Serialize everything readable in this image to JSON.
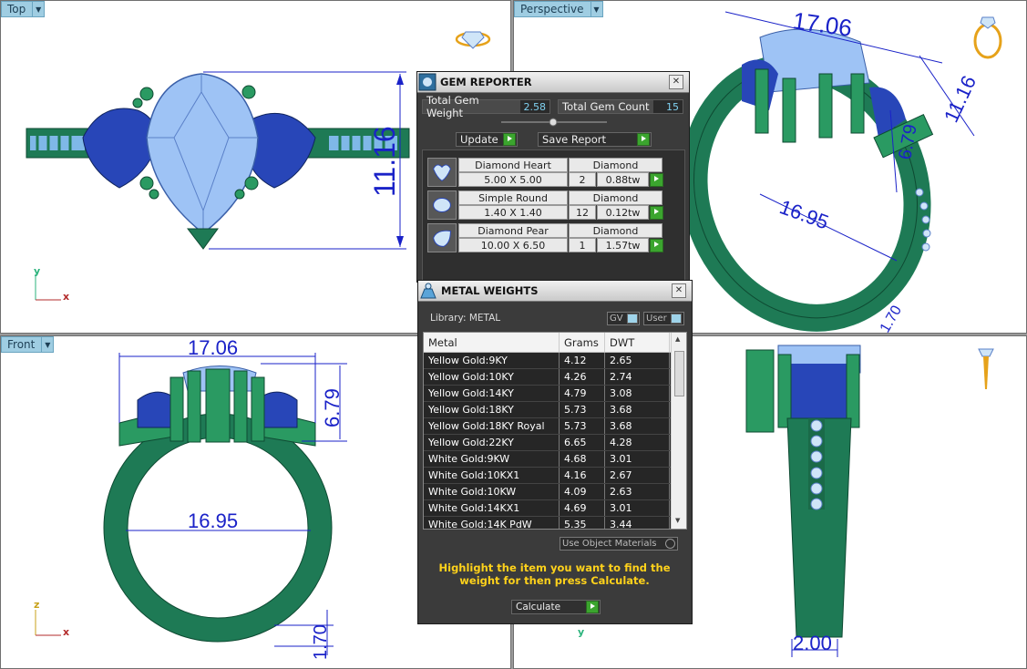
{
  "viewports": {
    "top": {
      "label": "Top",
      "dims": {
        "height": "11.16"
      }
    },
    "perspective": {
      "label": "Perspective",
      "dims": {
        "width": "17.06",
        "depth": "11.16",
        "inner": "16.95",
        "side": "6.79",
        "bottom": "1.70"
      }
    },
    "front": {
      "label": "Front",
      "dims": {
        "width": "17.06",
        "height": "6.79",
        "inner": "16.95",
        "band": "1.70"
      }
    },
    "right": {
      "label": "",
      "dims": {
        "band": "2.00"
      }
    }
  },
  "axes": {
    "x": "x",
    "y": "y",
    "z": "z"
  },
  "gem_reporter": {
    "title": "GEM REPORTER",
    "close": "✕",
    "total_weight_label": "Total Gem Weight",
    "total_weight_value": "2.58",
    "total_count_label": "Total Gem Count",
    "total_count_value": "15",
    "update_label": "Update",
    "save_report_label": "Save Report",
    "gems": [
      {
        "name": "Diamond Heart",
        "material": "Diamond",
        "size": "5.00 X 5.00",
        "count": "2",
        "weight": "0.88tw"
      },
      {
        "name": "Simple Round",
        "material": "Diamond",
        "size": "1.40 X 1.40",
        "count": "12",
        "weight": "0.12tw"
      },
      {
        "name": "Diamond Pear",
        "material": "Diamond",
        "size": "10.00 X 6.50",
        "count": "1",
        "weight": "1.57tw"
      }
    ]
  },
  "metal_weights": {
    "title": "METAL WEIGHTS",
    "close": "✕",
    "library_label": "Library: METAL",
    "gv_label": "GV",
    "user_label": "User",
    "columns": [
      "Metal",
      "Grams",
      "DWT"
    ],
    "rows": [
      [
        "Yellow Gold:9KY",
        "4.12",
        "2.65"
      ],
      [
        "Yellow Gold:10KY",
        "4.26",
        "2.74"
      ],
      [
        "Yellow Gold:14KY",
        "4.79",
        "3.08"
      ],
      [
        "Yellow Gold:18KY",
        "5.73",
        "3.68"
      ],
      [
        "Yellow Gold:18KY Royal",
        "5.73",
        "3.68"
      ],
      [
        "Yellow Gold:22KY",
        "6.65",
        "4.28"
      ],
      [
        "White Gold:9KW",
        "4.68",
        "3.01"
      ],
      [
        "White Gold:10KX1",
        "4.16",
        "2.67"
      ],
      [
        "White Gold:10KW",
        "4.09",
        "2.63"
      ],
      [
        "White Gold:14KX1",
        "4.69",
        "3.01"
      ],
      [
        "White Gold:14K PdW",
        "5.35",
        "3.44"
      ]
    ],
    "use_object_materials_label": "Use Object Materials",
    "hint": "Highlight the item you want to find the weight for then press Calculate.",
    "calculate_label": "Calculate"
  },
  "colors": {
    "ring_green": "#1e7a55",
    "gem_blue": "#2846b8",
    "center_gem": "#9ec3f5",
    "dim_blue": "#1a22c8"
  }
}
